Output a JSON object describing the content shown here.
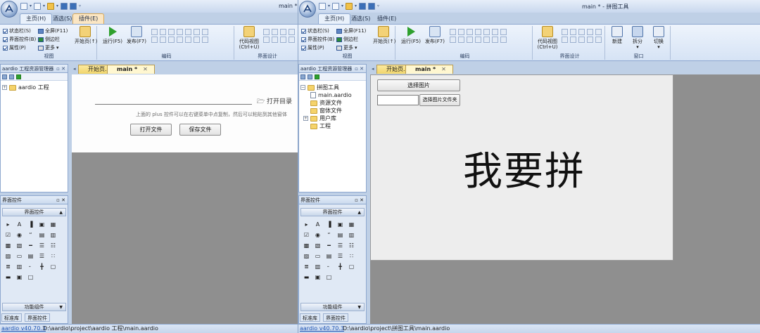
{
  "left_ide": {
    "title": "main * -",
    "tabs": [
      "主页(H)",
      "酒选(S)",
      "插件(E)"
    ],
    "ribbon": {
      "view_checks": [
        "状态栏(S)",
        "界面控件(B)",
        "属性(P)"
      ],
      "view_options": [
        "全屏(F11)",
        "侧边栏",
        "更多"
      ],
      "view_group": "视图",
      "start_page": "开始页(↑)",
      "run": "运行(F5)",
      "publish": "发布(F7)",
      "code_group": "编码",
      "code_view": "代码视图\n(Ctrl+U)",
      "design_group": "界面设计"
    },
    "doc_tabs": [
      "开始页...",
      "main *"
    ],
    "project_panel": {
      "title": "aardio 工程资源管理器",
      "root": "aardio 工程"
    },
    "toolbox": {
      "title": "界面控件",
      "section": "界面控件",
      "footer": "功能组件",
      "bottom_tabs": [
        "标准库",
        "界面控件"
      ]
    },
    "form": {
      "open_dir": "打开目录",
      "hint": "上面的 plus 控件可以在右键菜单中点复制，然后可以粘贴到其他窗体",
      "open_file_button": "打开文件",
      "save_file_button": "保存文件"
    },
    "status": {
      "version": "aardio v40.70.3",
      "path": "D:\\aardio\\project\\aardio 工程\\main.aardio"
    }
  },
  "right_ide": {
    "title": "main * - 拼图工具",
    "tabs": [
      "主页(H)",
      "酒选(S)",
      "插件(E)"
    ],
    "ribbon": {
      "view_checks": [
        "状态栏(S)",
        "界面控件(B)",
        "属性(P)"
      ],
      "view_options": [
        "全屏(F11)",
        "侧边栏",
        "更多"
      ],
      "view_group": "视图",
      "start_page": "开始页(↑)",
      "run": "运行(F5)",
      "publish": "发布(F7)",
      "code_group": "编码",
      "code_view": "代码视图\n(Ctrl+U)",
      "design_group": "界面设计",
      "new": "新建",
      "split": "拆分",
      "switch": "切换",
      "window_group": "窗口"
    },
    "doc_tabs": [
      "开始页...",
      "main *"
    ],
    "project_panel": {
      "title": "aardio 工程资源管理器",
      "root": "拼图工具",
      "items": [
        "main.aardio",
        "资源文件",
        "窗体文件",
        "用户库",
        "工程"
      ]
    },
    "toolbox": {
      "title": "界面控件",
      "section": "界面控件",
      "footer": "功能组件",
      "bottom_tabs": [
        "标准库",
        "界面控件"
      ]
    },
    "form": {
      "select_image_button": "选择图片",
      "select_folder_button": "选择图片文件夹",
      "folder_input_value": "",
      "big_label": "我要拼"
    },
    "status": {
      "version": "aardio v40.70.3",
      "path": "D:\\aardio\\project\\拼图工具\\main.aardio"
    }
  },
  "toolbox_glyphs": [
    "▸",
    "A",
    "▐",
    "▣",
    "▦",
    "☑",
    "◉",
    "“",
    "▤",
    "▥",
    "▩",
    "▧",
    "━",
    "☰",
    "☷",
    "▨",
    "▭",
    "▤",
    "☰",
    "∷",
    "≣",
    "▥",
    "╴",
    "╋",
    "▢",
    "▬",
    "▣",
    "□"
  ],
  "colors": {
    "ribbon_bg": "#d6e3f5",
    "doc_tab": "#f1d56a",
    "canvas": "#8f8f8f",
    "form": "#ededed",
    "link": "#1f55b5"
  }
}
